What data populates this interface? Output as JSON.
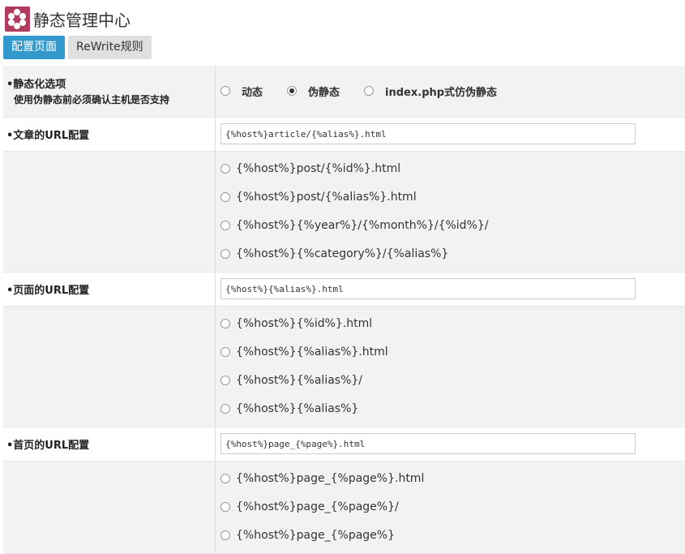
{
  "header": {
    "title": "静态管理中心",
    "logo_icon": "flower-logo-icon",
    "logo_color": "#b23c5e"
  },
  "tabs": [
    {
      "label": "配置页面",
      "active": true
    },
    {
      "label": "ReWrite规则",
      "active": false
    }
  ],
  "static_mode": {
    "label": "•静态化选项",
    "note": "使用伪静态前必须确认主机是否支持",
    "options": [
      "动态",
      "伪静态",
      "index.php式仿伪静态"
    ],
    "selected": 1
  },
  "article": {
    "label": "•文章的URL配置",
    "value": "{%host%}article/{%alias%}.html",
    "options": [
      "{%host%}post/{%id%}.html",
      "{%host%}post/{%alias%}.html",
      "{%host%}{%year%}/{%month%}/{%id%}/",
      "{%host%}{%category%}/{%alias%}"
    ]
  },
  "page": {
    "label": "•页面的URL配置",
    "value": "{%host%}{%alias%}.html",
    "options": [
      "{%host%}{%id%}.html",
      "{%host%}{%alias%}.html",
      "{%host%}{%alias%}/",
      "{%host%}{%alias%}"
    ]
  },
  "home": {
    "label": "•首页的URL配置",
    "value": "{%host%}page_{%page%}.html",
    "options": [
      "{%host%}page_{%page%}.html",
      "{%host%}page_{%page%}/",
      "{%host%}page_{%page%}"
    ]
  },
  "colors": {
    "accent": "#3399cc",
    "row_gray": "#f2f2f2"
  }
}
